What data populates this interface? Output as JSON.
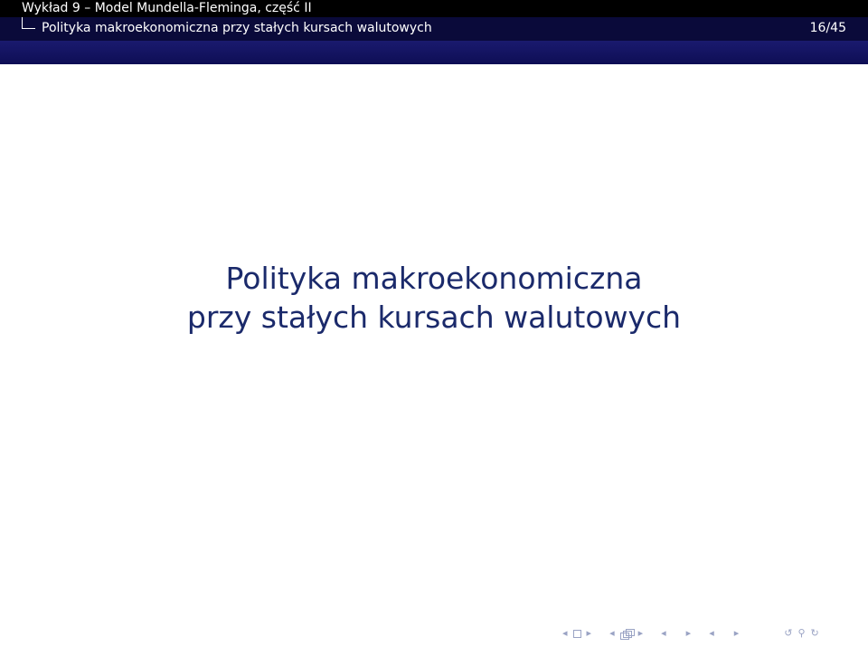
{
  "header": {
    "presentation_title": "Wykład 9 – Model Mundella-Fleminga, część II",
    "section_title": "Polityka makroekonomiczna przy stałych kursach walutowych",
    "page_counter": "16/45"
  },
  "slide": {
    "title_line1": "Polityka makroekonomiczna",
    "title_line2": "przy stałych kursach walutowych"
  },
  "navigation": {
    "icons": [
      "prev-arrow-icon",
      "slide-box-icon",
      "next-arrow-icon",
      "prev-arrow-icon",
      "frames-icon",
      "next-arrow-icon",
      "prev-arrow-icon",
      "subsection-icon",
      "next-arrow-icon",
      "prev-arrow-icon",
      "section-icon",
      "next-arrow-icon",
      "align-icon",
      "undo-icon",
      "search-icon"
    ],
    "color": "#9aa3c4"
  },
  "colors": {
    "header_bg": "#000000",
    "section_bg": "#0a0a3a",
    "band_bg": "#1a1a6e",
    "title_color": "#1b2a6b"
  }
}
